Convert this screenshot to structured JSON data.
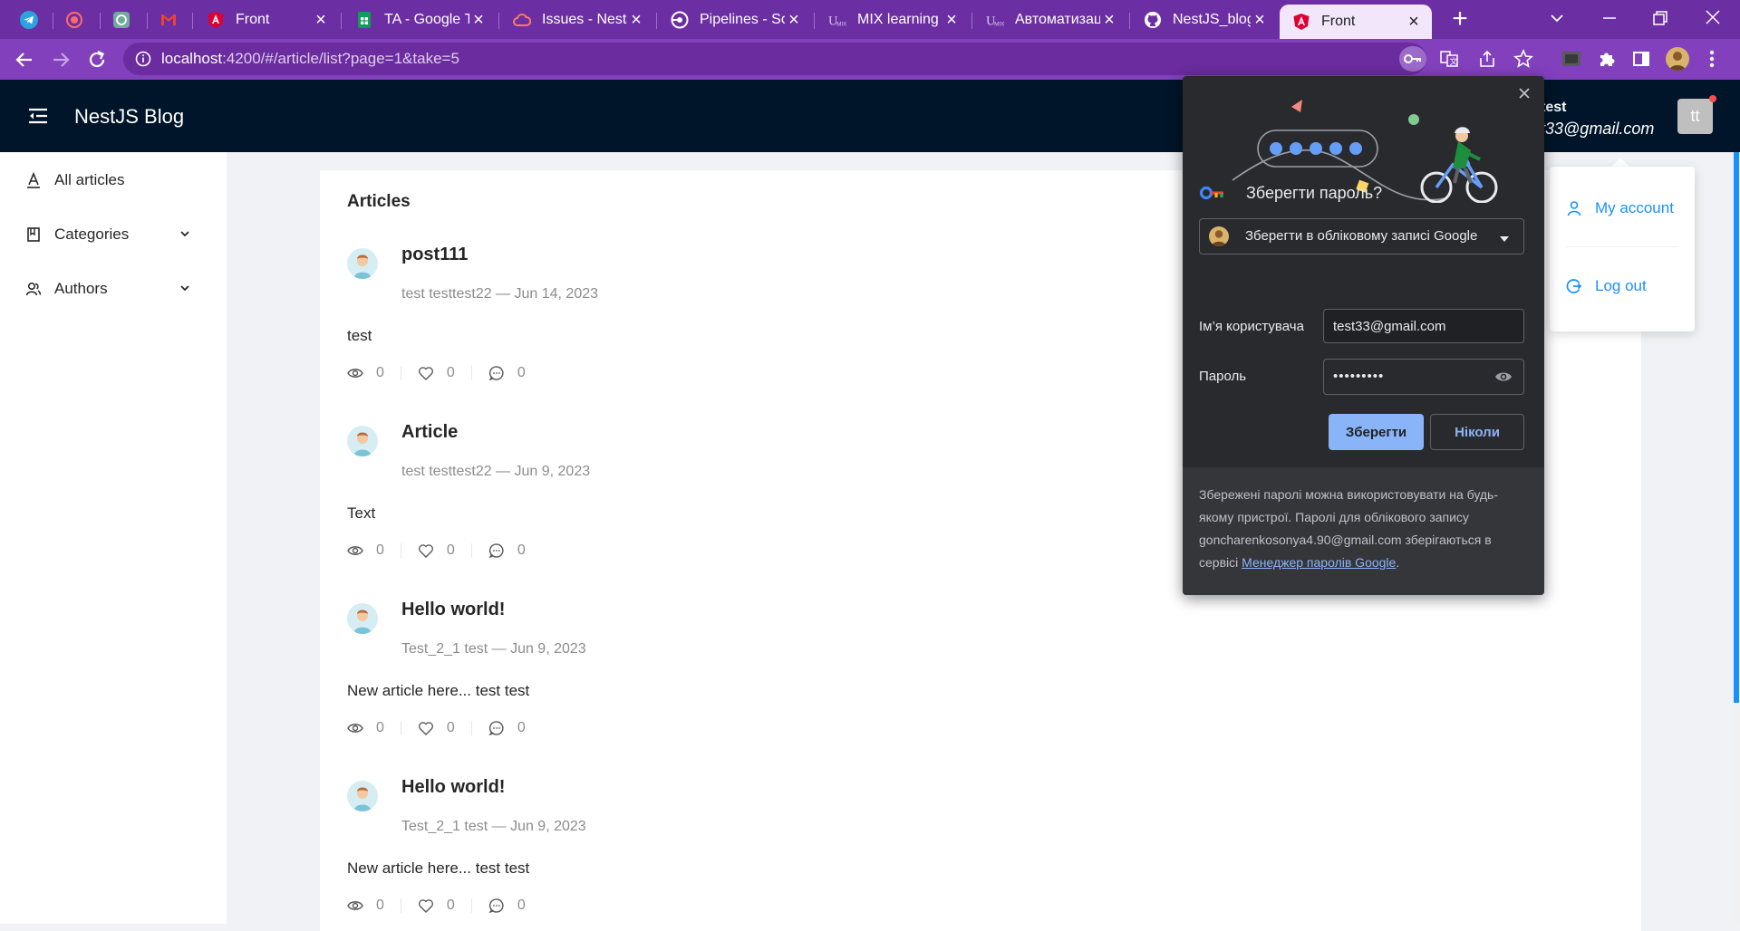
{
  "browser": {
    "tabs": [
      {
        "label": "",
        "icon": "telegram-icon"
      },
      {
        "label": "",
        "icon": "record-icon"
      },
      {
        "label": "",
        "icon": "chatgpt-icon"
      },
      {
        "label": "",
        "icon": "gmail-icon"
      },
      {
        "label": "Front",
        "icon": "angular-icon"
      },
      {
        "label": "TA - Google Т",
        "icon": "google-sheets-icon"
      },
      {
        "label": "Issues - NestJ",
        "icon": "cloud-icon"
      },
      {
        "label": "Pipelines - So",
        "icon": "pipelines-icon"
      },
      {
        "label": "MIX learning",
        "icon": "mix-icon"
      },
      {
        "label": "Автоматизаці",
        "icon": "mix-icon"
      },
      {
        "label": "NestJS_blog/ap",
        "icon": "github-icon"
      },
      {
        "label": "Front",
        "icon": "angular-icon",
        "active": true
      }
    ],
    "new_tab": "+",
    "address": {
      "host": "localhost",
      "path": ":4200/#/article/list?page=1&take=5"
    },
    "colors": {
      "frame": "#6b2fa3",
      "toolbar": "#8240bd"
    }
  },
  "app": {
    "title": "NestJS Blog",
    "user": {
      "name": "test",
      "email": "test33@gmail.com",
      "avatar_initials": "tt"
    },
    "colors": {
      "header": "#001529",
      "accent": "#1890ff"
    }
  },
  "sidebar": {
    "items": [
      {
        "label": "All articles",
        "icon": "font-icon"
      },
      {
        "label": "Categories",
        "icon": "book-icon",
        "expandable": true
      },
      {
        "label": "Authors",
        "icon": "team-icon",
        "expandable": true
      }
    ]
  },
  "main": {
    "heading": "Articles",
    "articles": [
      {
        "title": "post111",
        "author": "test testtest22",
        "date": "Jun 14, 2023",
        "body": "test",
        "views": "0",
        "likes": "0",
        "comments": "0"
      },
      {
        "title": "Article",
        "author": "test testtest22",
        "date": "Jun 9, 2023",
        "body": "Text",
        "views": "0",
        "likes": "0",
        "comments": "0"
      },
      {
        "title": "Hello world!",
        "author": "Test_2_1 test",
        "date": "Jun 9, 2023",
        "body": "New article here... test test",
        "views": "0",
        "likes": "0",
        "comments": "0"
      },
      {
        "title": "Hello world!",
        "author": "Test_2_1 test",
        "date": "Jun 9, 2023",
        "body": "New article here... test test",
        "views": "0",
        "likes": "0",
        "comments": "0"
      }
    ]
  },
  "user_menu": {
    "items": [
      {
        "label": "My account",
        "icon": "user-icon"
      },
      {
        "label": "Log out",
        "icon": "logout-icon"
      }
    ]
  },
  "password_prompt": {
    "title": "Зберегти пароль?",
    "account_option": "Зберегти в обліковому записі Google",
    "username_label": "Ім’я користувача",
    "username_value": "test33@gmail.com",
    "password_label": "Пароль",
    "password_value": "•••••••••",
    "save_label": "Зберегти",
    "never_label": "Ніколи",
    "footer_text": "Збережені паролі можна використовувати на будь-якому пристрої. Паролі для облікового запису goncharenkosonya4.90@gmail.com зберігаються в сервісі ",
    "footer_link": "Менеджер паролів Google",
    "footer_end": "."
  }
}
